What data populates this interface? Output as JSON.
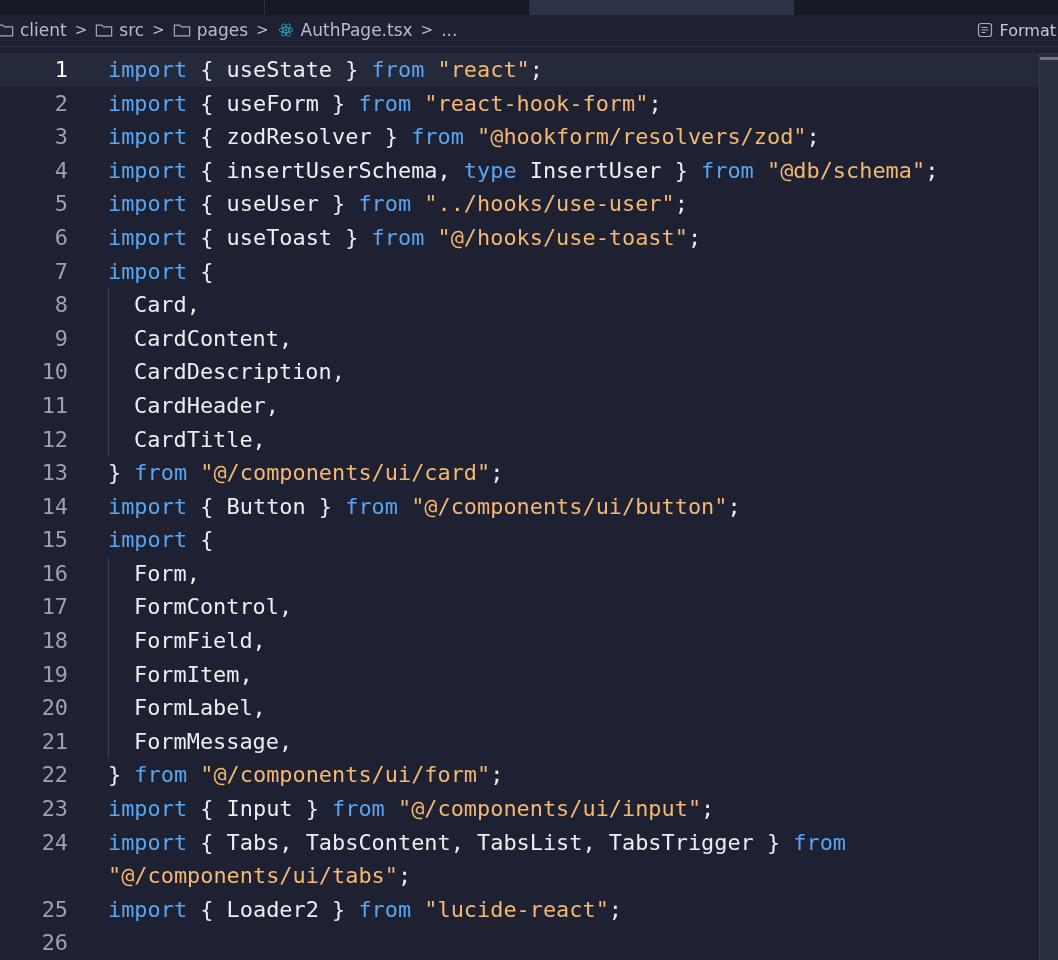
{
  "editor_tabs": [
    {
      "selected": false
    },
    {
      "selected": false
    },
    {
      "selected": true
    },
    {
      "selected": false
    }
  ],
  "breadcrumb": [
    {
      "label": "client",
      "kind": "folder"
    },
    {
      "label": "src",
      "kind": "folder"
    },
    {
      "label": "pages",
      "kind": "folder"
    },
    {
      "label": "AuthPage.tsx",
      "kind": "file"
    },
    {
      "label": "...",
      "kind": "more"
    }
  ],
  "separator": ">",
  "format_button": {
    "label": "Format"
  },
  "lines": [
    {
      "number": "1",
      "current": true,
      "guide": false,
      "tokens": [
        {
          "kind": "keyword",
          "text": "import"
        },
        {
          "kind": "plain",
          "text": " { useState } "
        },
        {
          "kind": "keyword",
          "text": "from"
        },
        {
          "kind": "string",
          "text": " \"react\""
        },
        {
          "kind": "plain",
          "text": ";"
        }
      ]
    },
    {
      "number": "2",
      "current": false,
      "guide": false,
      "tokens": [
        {
          "kind": "keyword",
          "text": "import"
        },
        {
          "kind": "plain",
          "text": " { useForm } "
        },
        {
          "kind": "keyword",
          "text": "from"
        },
        {
          "kind": "string",
          "text": " \"react-hook-form\""
        },
        {
          "kind": "plain",
          "text": ";"
        }
      ]
    },
    {
      "number": "3",
      "current": false,
      "guide": false,
      "tokens": [
        {
          "kind": "keyword",
          "text": "import"
        },
        {
          "kind": "plain",
          "text": " { zodResolver } "
        },
        {
          "kind": "keyword",
          "text": "from"
        },
        {
          "kind": "string",
          "text": " \"@hookform/resolvers/zod\""
        },
        {
          "kind": "plain",
          "text": ";"
        }
      ]
    },
    {
      "number": "4",
      "current": false,
      "guide": false,
      "tokens": [
        {
          "kind": "keyword",
          "text": "import"
        },
        {
          "kind": "plain",
          "text": " { insertUserSchema, "
        },
        {
          "kind": "keyword",
          "text": "type"
        },
        {
          "kind": "plain",
          "text": " InsertUser } "
        },
        {
          "kind": "keyword",
          "text": "from"
        },
        {
          "kind": "string",
          "text": " \"@db/schema\""
        },
        {
          "kind": "plain",
          "text": ";"
        }
      ]
    },
    {
      "number": "5",
      "current": false,
      "guide": false,
      "tokens": [
        {
          "kind": "keyword",
          "text": "import"
        },
        {
          "kind": "plain",
          "text": " { useUser } "
        },
        {
          "kind": "keyword",
          "text": "from"
        },
        {
          "kind": "string",
          "text": " \"../hooks/use-user\""
        },
        {
          "kind": "plain",
          "text": ";"
        }
      ]
    },
    {
      "number": "6",
      "current": false,
      "guide": false,
      "tokens": [
        {
          "kind": "keyword",
          "text": "import"
        },
        {
          "kind": "plain",
          "text": " { useToast } "
        },
        {
          "kind": "keyword",
          "text": "from"
        },
        {
          "kind": "string",
          "text": " \"@/hooks/use-toast\""
        },
        {
          "kind": "plain",
          "text": ";"
        }
      ]
    },
    {
      "number": "7",
      "current": false,
      "guide": false,
      "tokens": [
        {
          "kind": "keyword",
          "text": "import"
        },
        {
          "kind": "plain",
          "text": " {"
        }
      ]
    },
    {
      "number": "8",
      "current": false,
      "guide": true,
      "tokens": [
        {
          "kind": "plain",
          "text": "Card,"
        }
      ]
    },
    {
      "number": "9",
      "current": false,
      "guide": true,
      "tokens": [
        {
          "kind": "plain",
          "text": "CardContent,"
        }
      ]
    },
    {
      "number": "10",
      "current": false,
      "guide": true,
      "tokens": [
        {
          "kind": "plain",
          "text": "CardDescription,"
        }
      ]
    },
    {
      "number": "11",
      "current": false,
      "guide": true,
      "tokens": [
        {
          "kind": "plain",
          "text": "CardHeader,"
        }
      ]
    },
    {
      "number": "12",
      "current": false,
      "guide": true,
      "tokens": [
        {
          "kind": "plain",
          "text": "CardTitle,"
        }
      ]
    },
    {
      "number": "13",
      "current": false,
      "guide": false,
      "tokens": [
        {
          "kind": "plain",
          "text": "} "
        },
        {
          "kind": "keyword",
          "text": "from"
        },
        {
          "kind": "string",
          "text": " \"@/components/ui/card\""
        },
        {
          "kind": "plain",
          "text": ";"
        }
      ]
    },
    {
      "number": "14",
      "current": false,
      "guide": false,
      "tokens": [
        {
          "kind": "keyword",
          "text": "import"
        },
        {
          "kind": "plain",
          "text": " { Button } "
        },
        {
          "kind": "keyword",
          "text": "from"
        },
        {
          "kind": "string",
          "text": " \"@/components/ui/button\""
        },
        {
          "kind": "plain",
          "text": ";"
        }
      ]
    },
    {
      "number": "15",
      "current": false,
      "guide": false,
      "tokens": [
        {
          "kind": "keyword",
          "text": "import"
        },
        {
          "kind": "plain",
          "text": " {"
        }
      ]
    },
    {
      "number": "16",
      "current": false,
      "guide": true,
      "tokens": [
        {
          "kind": "plain",
          "text": "Form,"
        }
      ]
    },
    {
      "number": "17",
      "current": false,
      "guide": true,
      "tokens": [
        {
          "kind": "plain",
          "text": "FormControl,"
        }
      ]
    },
    {
      "number": "18",
      "current": false,
      "guide": true,
      "tokens": [
        {
          "kind": "plain",
          "text": "FormField,"
        }
      ]
    },
    {
      "number": "19",
      "current": false,
      "guide": true,
      "tokens": [
        {
          "kind": "plain",
          "text": "FormItem,"
        }
      ]
    },
    {
      "number": "20",
      "current": false,
      "guide": true,
      "tokens": [
        {
          "kind": "plain",
          "text": "FormLabel,"
        }
      ]
    },
    {
      "number": "21",
      "current": false,
      "guide": true,
      "tokens": [
        {
          "kind": "plain",
          "text": "FormMessage,"
        }
      ]
    },
    {
      "number": "22",
      "current": false,
      "guide": false,
      "tokens": [
        {
          "kind": "plain",
          "text": "} "
        },
        {
          "kind": "keyword",
          "text": "from"
        },
        {
          "kind": "string",
          "text": " \"@/components/ui/form\""
        },
        {
          "kind": "plain",
          "text": ";"
        }
      ]
    },
    {
      "number": "23",
      "current": false,
      "guide": false,
      "tokens": [
        {
          "kind": "keyword",
          "text": "import"
        },
        {
          "kind": "plain",
          "text": " { Input } "
        },
        {
          "kind": "keyword",
          "text": "from"
        },
        {
          "kind": "string",
          "text": " \"@/components/ui/input\""
        },
        {
          "kind": "plain",
          "text": ";"
        }
      ]
    },
    {
      "number": "24",
      "current": false,
      "guide": false,
      "tokens": [
        {
          "kind": "keyword",
          "text": "import"
        },
        {
          "kind": "plain",
          "text": " { Tabs, TabsContent, TabsList, TabsTrigger } "
        },
        {
          "kind": "keyword",
          "text": "from"
        },
        {
          "kind": "string",
          "text": " \"@/components/ui/tabs\""
        },
        {
          "kind": "plain",
          "text": ";"
        }
      ]
    },
    {
      "number": "25",
      "current": false,
      "guide": false,
      "tokens": [
        {
          "kind": "keyword",
          "text": "import"
        },
        {
          "kind": "plain",
          "text": " { Loader2 } "
        },
        {
          "kind": "keyword",
          "text": "from"
        },
        {
          "kind": "string",
          "text": " \"lucide-react\""
        },
        {
          "kind": "plain",
          "text": ";"
        }
      ]
    },
    {
      "number": "26",
      "current": false,
      "guide": false
    }
  ]
}
